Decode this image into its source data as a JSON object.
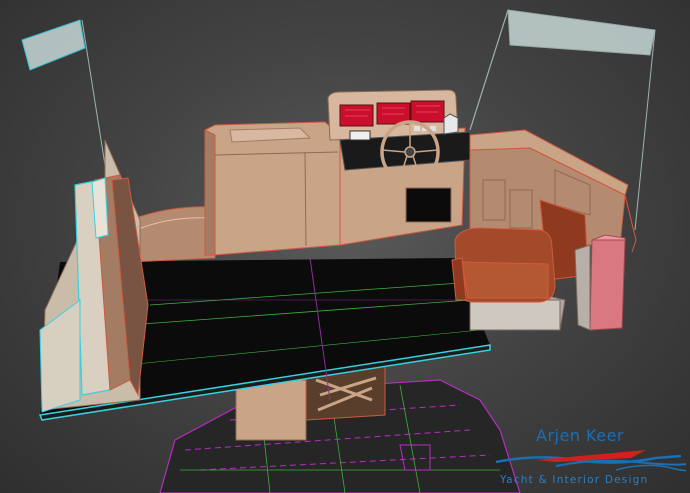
{
  "viewport": {
    "background": "#454545",
    "colors": {
      "wood": "#c9a487",
      "wood_dark": "#8f6a55",
      "edge_red": "#d05a3f",
      "edge_cyan": "#38d0e0",
      "floor": "#0b0b0b",
      "grid_green": "#3fae3f",
      "grid_magenta": "#b52ec0",
      "seat": "#a34a2a",
      "panel_red": "#c8102e",
      "glass": "#bfcfcd",
      "stool_pink": "#d9787f"
    }
  },
  "logo": {
    "name": "Arjen Keer",
    "tagline": "Yacht & Interior Design",
    "colors": {
      "text": "#1a6fb5",
      "wave_red": "#d0221d",
      "wave_blue": "#1a6fb5"
    }
  }
}
